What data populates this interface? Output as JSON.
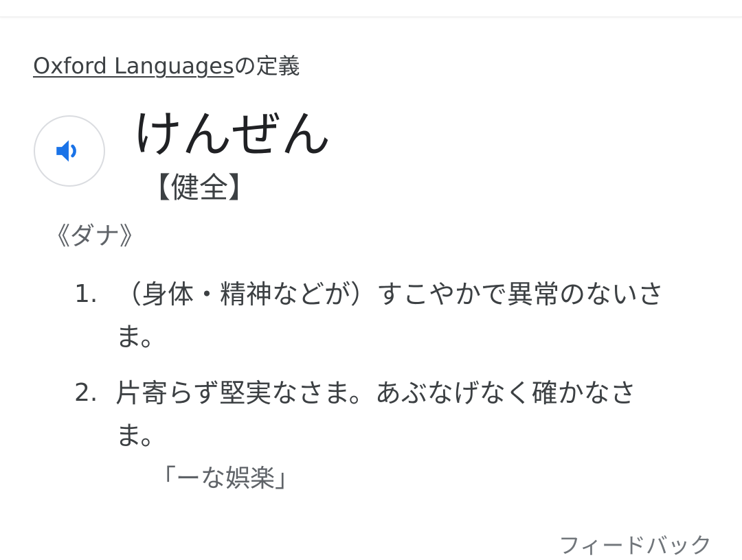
{
  "source": {
    "link_text": "Oxford Languages",
    "suffix": "の定義"
  },
  "entry": {
    "headword": "けんぜん",
    "kanji": "【健全】",
    "part_of_speech": "《ダナ》",
    "audio_icon": "speaker-icon",
    "accent_color": "#1a73e8",
    "definitions": [
      {
        "number": "1.",
        "text": "（身体・精神などが）すこやかで異常のないさま。",
        "example": ""
      },
      {
        "number": "2.",
        "text": "片寄らず堅実なさま。あぶなげなく確かなさま。",
        "example": "「ーな娯楽」"
      }
    ]
  },
  "feedback": {
    "label": "フィードバック"
  }
}
